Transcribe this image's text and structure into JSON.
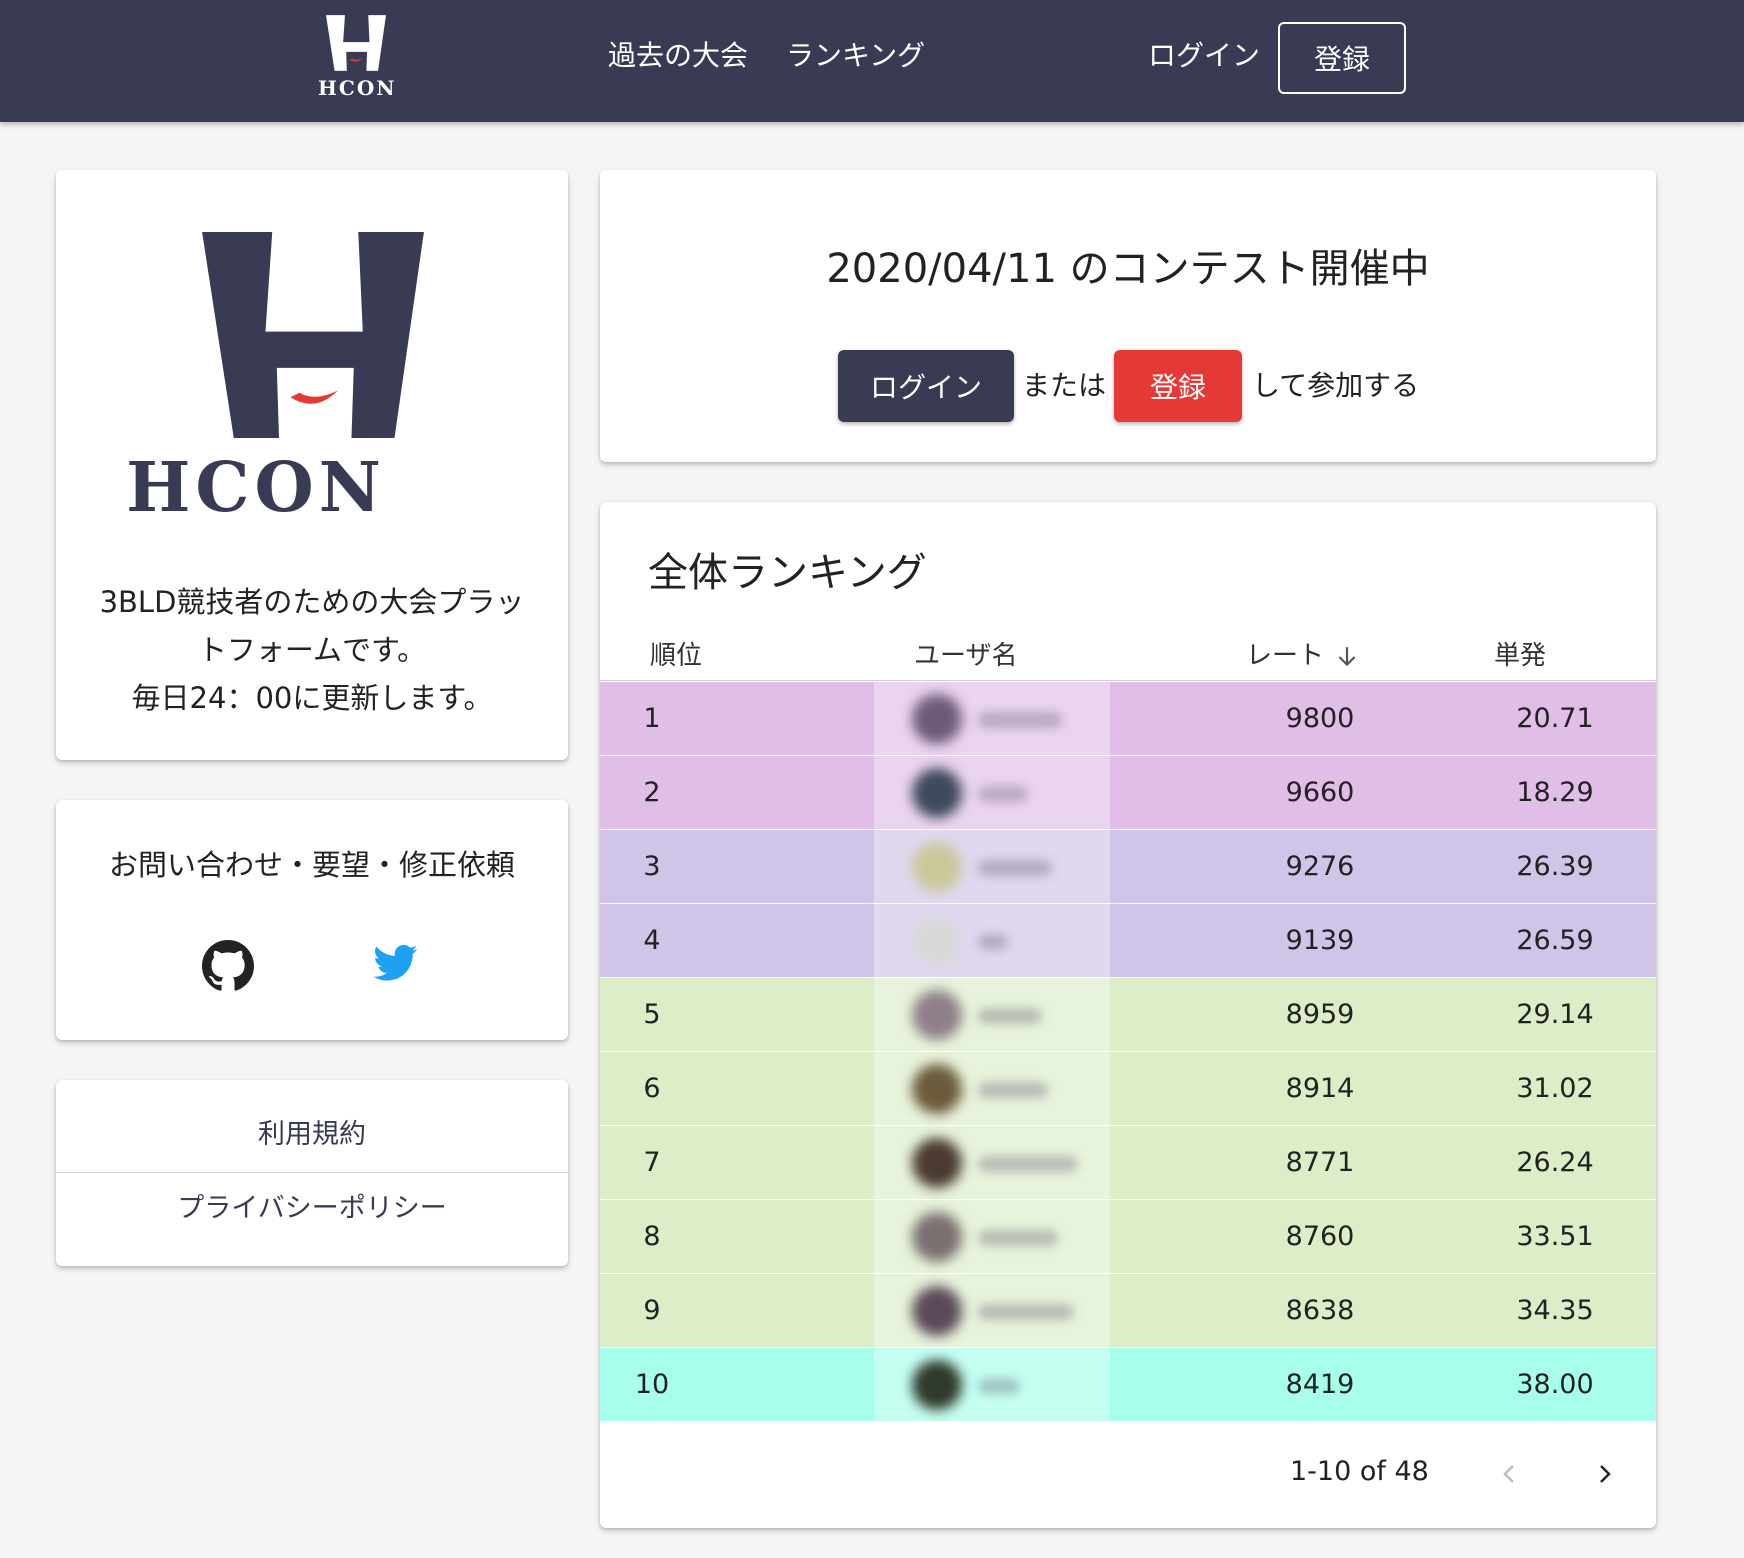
{
  "nav": {
    "logo_text": "HCON",
    "past_contests": "過去の大会",
    "ranking": "ランキング",
    "login": "ログイン",
    "register": "登録"
  },
  "about": {
    "logo_text": "HCON",
    "description_line1": "3BLD競技者のための大会プラッ",
    "description_line2": "トフォームです。",
    "description_line3": "毎日24：00に更新します。"
  },
  "contact": {
    "title": "お問い合わせ・要望・修正依頼",
    "icons": [
      "github-icon",
      "twitter-icon"
    ]
  },
  "links": {
    "terms": "利用規約",
    "privacy": "プライバシーポリシー"
  },
  "contest": {
    "title": "2020/04/11 のコンテスト開催中",
    "login_button": "ログイン",
    "or_text": "または",
    "register_button": "登録",
    "join_text": "して参加する"
  },
  "ranking": {
    "title": "全体ランキング",
    "columns": {
      "rank": "順位",
      "user": "ユーザ名",
      "rate": "レート",
      "single": "単発"
    },
    "rows": [
      {
        "rank": "1",
        "rate": "9800",
        "single": "20.71",
        "color": "#e1bee7"
      },
      {
        "rank": "2",
        "rate": "9660",
        "single": "18.29",
        "color": "#e1bee7"
      },
      {
        "rank": "3",
        "rate": "9276",
        "single": "26.39",
        "color": "#d1c4e9"
      },
      {
        "rank": "4",
        "rate": "9139",
        "single": "26.59",
        "color": "#d1c4e9"
      },
      {
        "rank": "5",
        "rate": "8959",
        "single": "29.14",
        "color": "#dcedc8"
      },
      {
        "rank": "6",
        "rate": "8914",
        "single": "31.02",
        "color": "#dcedc8"
      },
      {
        "rank": "7",
        "rate": "8771",
        "single": "26.24",
        "color": "#dcedc8"
      },
      {
        "rank": "8",
        "rate": "8760",
        "single": "33.51",
        "color": "#dcedc8"
      },
      {
        "rank": "9",
        "rate": "8638",
        "single": "34.35",
        "color": "#dcedc8"
      },
      {
        "rank": "10",
        "rate": "8419",
        "single": "38.00",
        "color": "#a7ffeb"
      }
    ],
    "pagination": "1-10 of 48"
  },
  "colors": {
    "brand": "#393b55",
    "accent_red": "#e53935",
    "twitter": "#1da1f2"
  }
}
